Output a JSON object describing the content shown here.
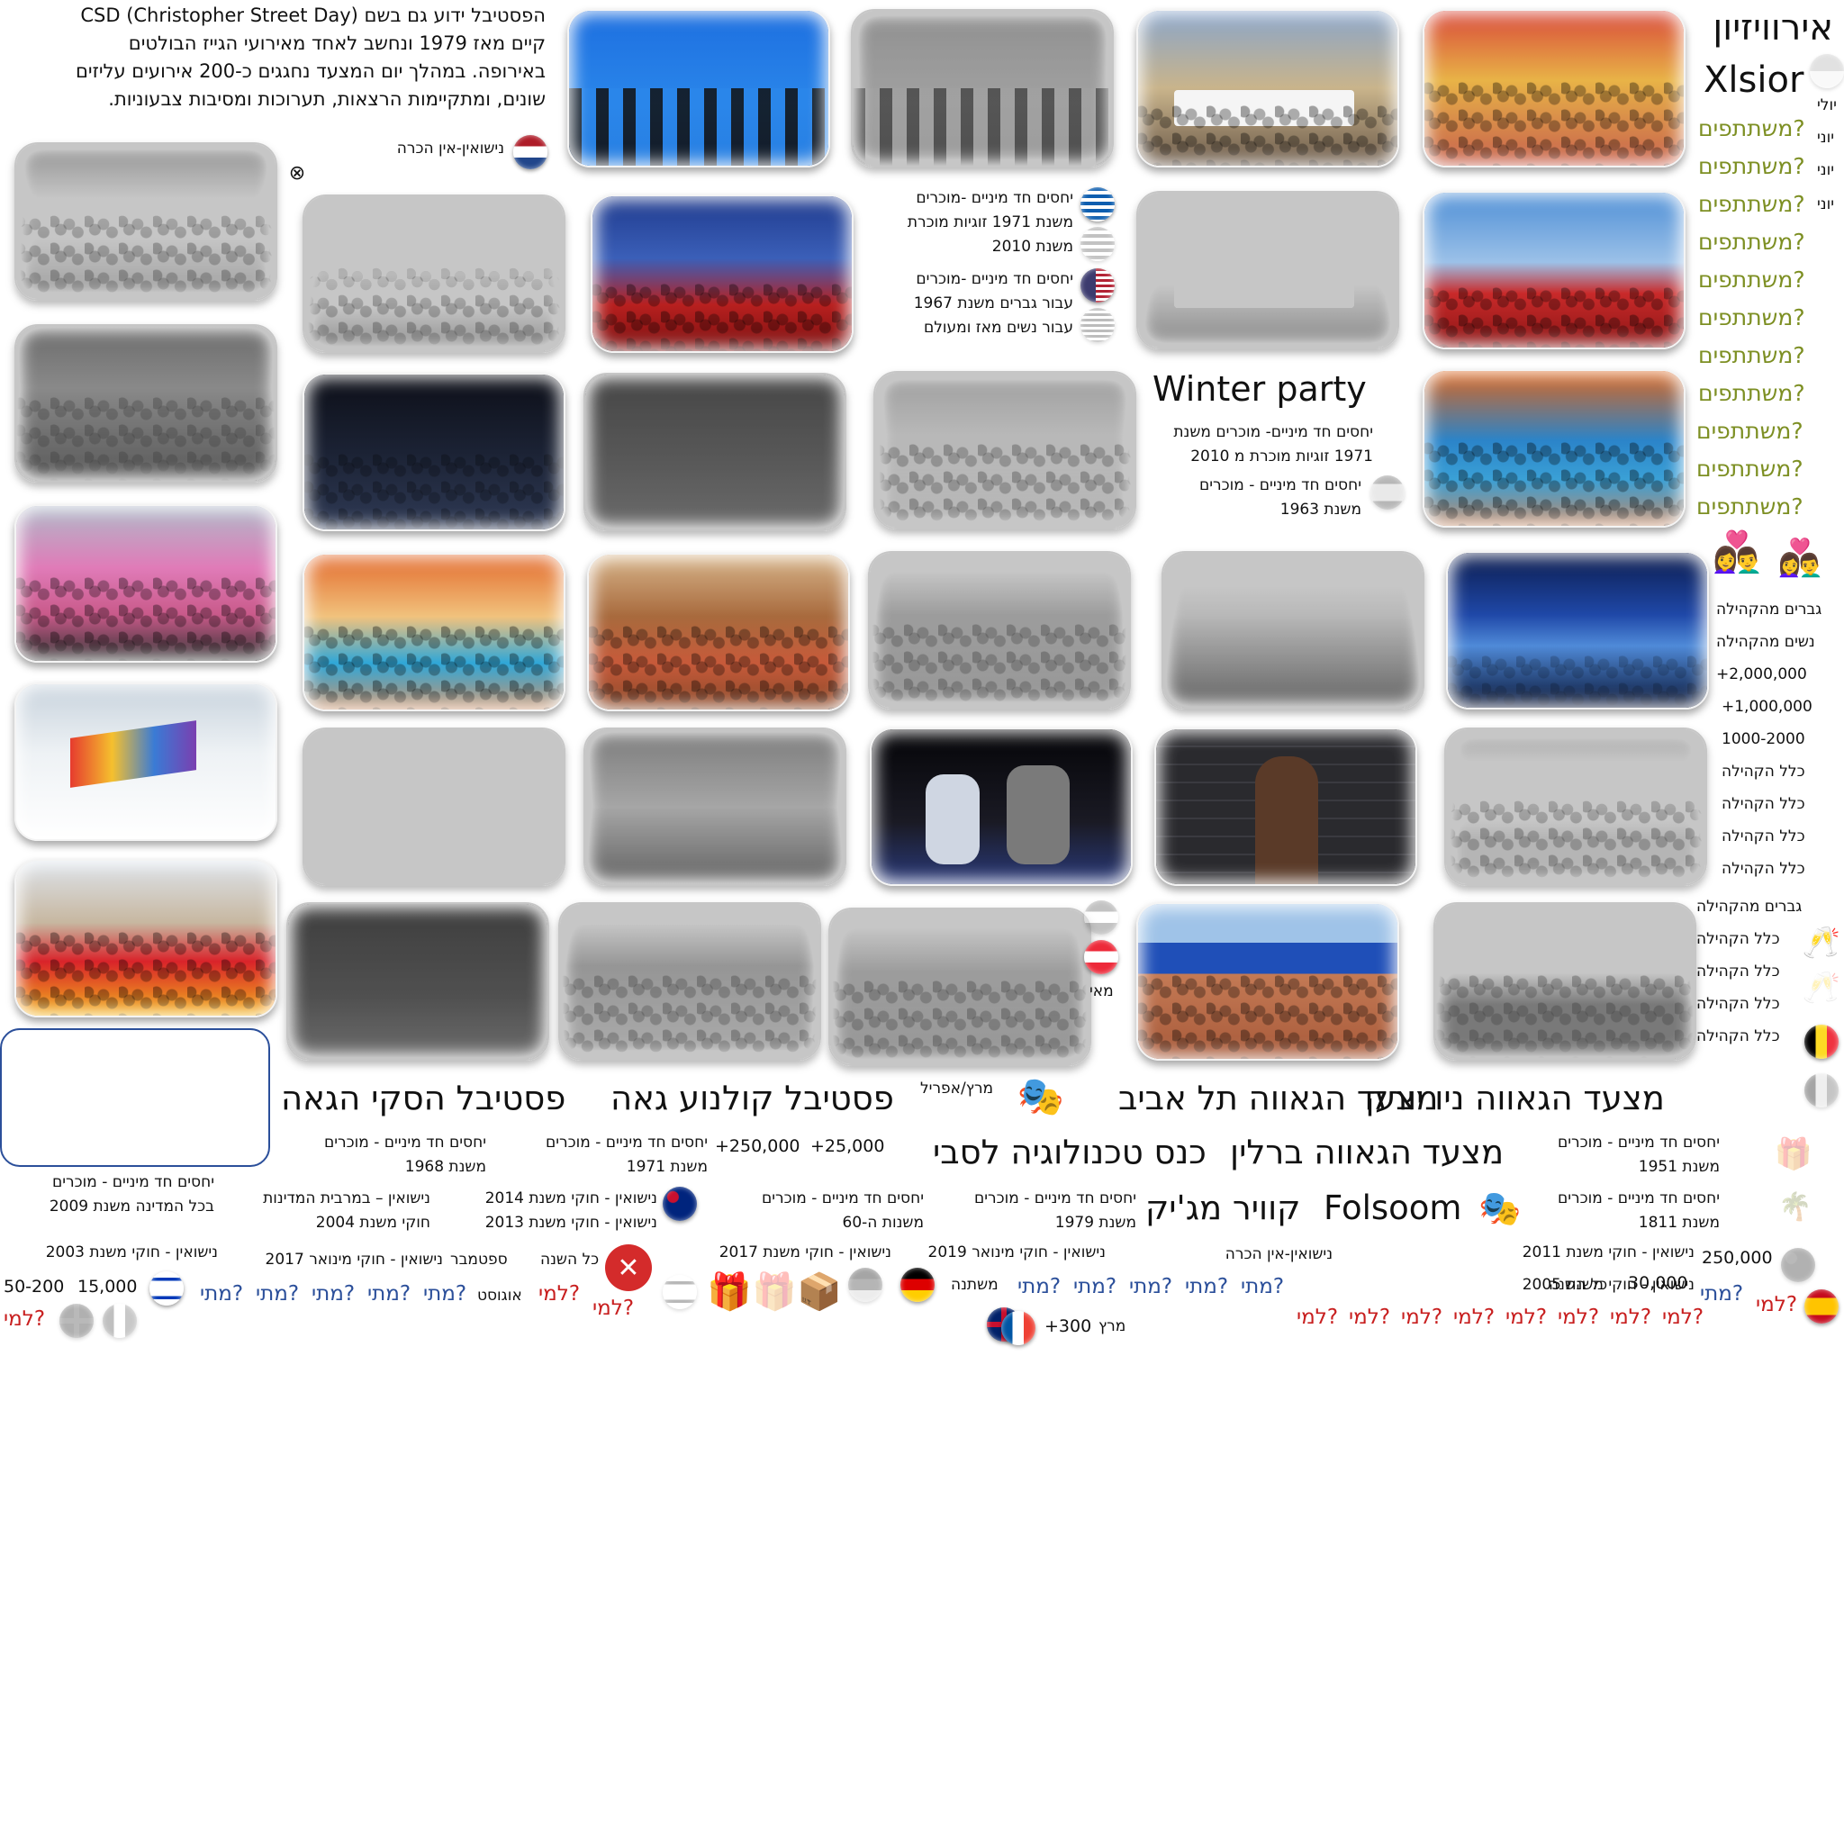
{
  "intro": {
    "lines": [
      "הפסטיבל ידוע גם בשם CSD (Christopher Street Day)",
      "קיים מאז 1979 ונחשב לאחד מאירועי הגייז הבולטים",
      "באירופה. במהלך יום המצעד נחגגים כ-200 אירועים עליזים",
      "שונים, ומתקיימות הרצאות, תערוכות ומסיבות צבעוניות."
    ],
    "netherlands_note": "נישואין-אין הכרה"
  },
  "right_column": {
    "eurovision": "אירוויזיון",
    "xlsior": "Xlsior",
    "months": [
      "יולי",
      "יוני",
      "יוני",
      "יוני"
    ],
    "participants_label": "משתתפים?",
    "couples_legend": [
      "גברים מהקהילה",
      "נשים מהקהילה"
    ],
    "sizes": [
      "+2,000,000",
      "+1,000,000",
      "1000-2000"
    ],
    "audiences": [
      "כלל הקהילה",
      "כלל הקהילה",
      "כלל הקהילה",
      "כלל הקהילה"
    ],
    "audiences2": [
      "גברים מהקהילה",
      "כלל הקהילה",
      "כלל הקהילה",
      "כלל הקהילה",
      "כלל הקהילה"
    ]
  },
  "legal_notes": {
    "greece_1": "יחסים חד מיניים -מוכרים",
    "greece_2": "משנת 1971 זוגיות מוכרת",
    "greece_3": "משנת 2010",
    "usa_1": "יחסים חד מיניים -מוכרים",
    "usa_2": "עבור גברים משנת 1967",
    "usa_3": "עבור נשים מאז ומעולם",
    "winter_party": "Winter party",
    "wp_1": "יחסים חד מיניים- מוכרים משנת",
    "wp_2": "1971 זוגיות מוכרת מ 2010",
    "wp_3": "יחסים חד מיניים - מוכרים",
    "wp_4": "משנת 1963",
    "may": "מאי"
  },
  "events": {
    "ny_pride": "מצעד הגאווה ניו יורק",
    "ta_pride": "מצעד הגאווה תל אביב",
    "march_april": "מרץ/אפריל",
    "film_festival": "פסטיבל קולנוע גאה",
    "ski_festival": "פסטיבל הסקי הגאה",
    "berlin_pride": "מצעד הגאווה ברלין",
    "tech_conf": "כנס טכנולוגיה לסבי",
    "folsom": "Folsoom",
    "queer_magic": "קוויר מג'יק"
  },
  "bottom_notes": {
    "n1951_a": "יחסים חד מיניים - מוכרים",
    "n1951_b": "משנת 1951",
    "n1811_a": "יחסים חד מיניים - מוכרים",
    "n1811_b": "משנת 1811",
    "n1968_a": "יחסים חד מיניים - מוכרים",
    "n1968_b": "משנת 1968",
    "n1971_a": "יחסים חד מיניים - מוכרים",
    "n1971_b": "משנת 1971",
    "n2009_a": "יחסים חד מיניים - מוכרים",
    "n2009_b": "בכל המדינה משנת 2009",
    "n2004_a": "נישואין – במרבית המדינות",
    "n2004_b": "חוקי משנת 2004",
    "n2014": "נישואין - חוקי משנת 2014",
    "n2013": "נישואין - חוקי משנת 2013",
    "n60_a": "יחסים חד מיניים - מוכרים",
    "n60_b": "משנות ה-60",
    "n1979_a": "יחסים חד מיניים - מוכרים",
    "n1979_b": "משנת 1979",
    "n2003": "נישואין - חוקי משנת 2003",
    "n2017a": "נישואין - חוקי מינואר 2017",
    "n2017b": "נישואין - חוקי משנת 2017",
    "n2019": "נישואין - חוקי מינואר 2019",
    "no_recognition": "נישואין-אין הכרה",
    "n2011": "נישואין - חוקי משנת 2011",
    "n2005": "נישואין - חוקי משנת 2005"
  },
  "stats": {
    "s250k_plus": "+250,000",
    "s25k_plus": "+25,000",
    "s250k": "250,000",
    "s30k": "30,000",
    "s15k": "15,000",
    "s50_200": "50-200",
    "s300": "+300",
    "every_year": "כל השנה",
    "every_year2": "כל השנה",
    "september": "ספטמבר",
    "august": "אוגוסט",
    "march": "מרץ",
    "annual": "משתנה"
  },
  "placeholders": {
    "when": "מתי?",
    "who": "למי?"
  },
  "colors": {
    "green": "#7d8f23",
    "blue": "#2b4f9a",
    "red": "#c81f1f"
  }
}
